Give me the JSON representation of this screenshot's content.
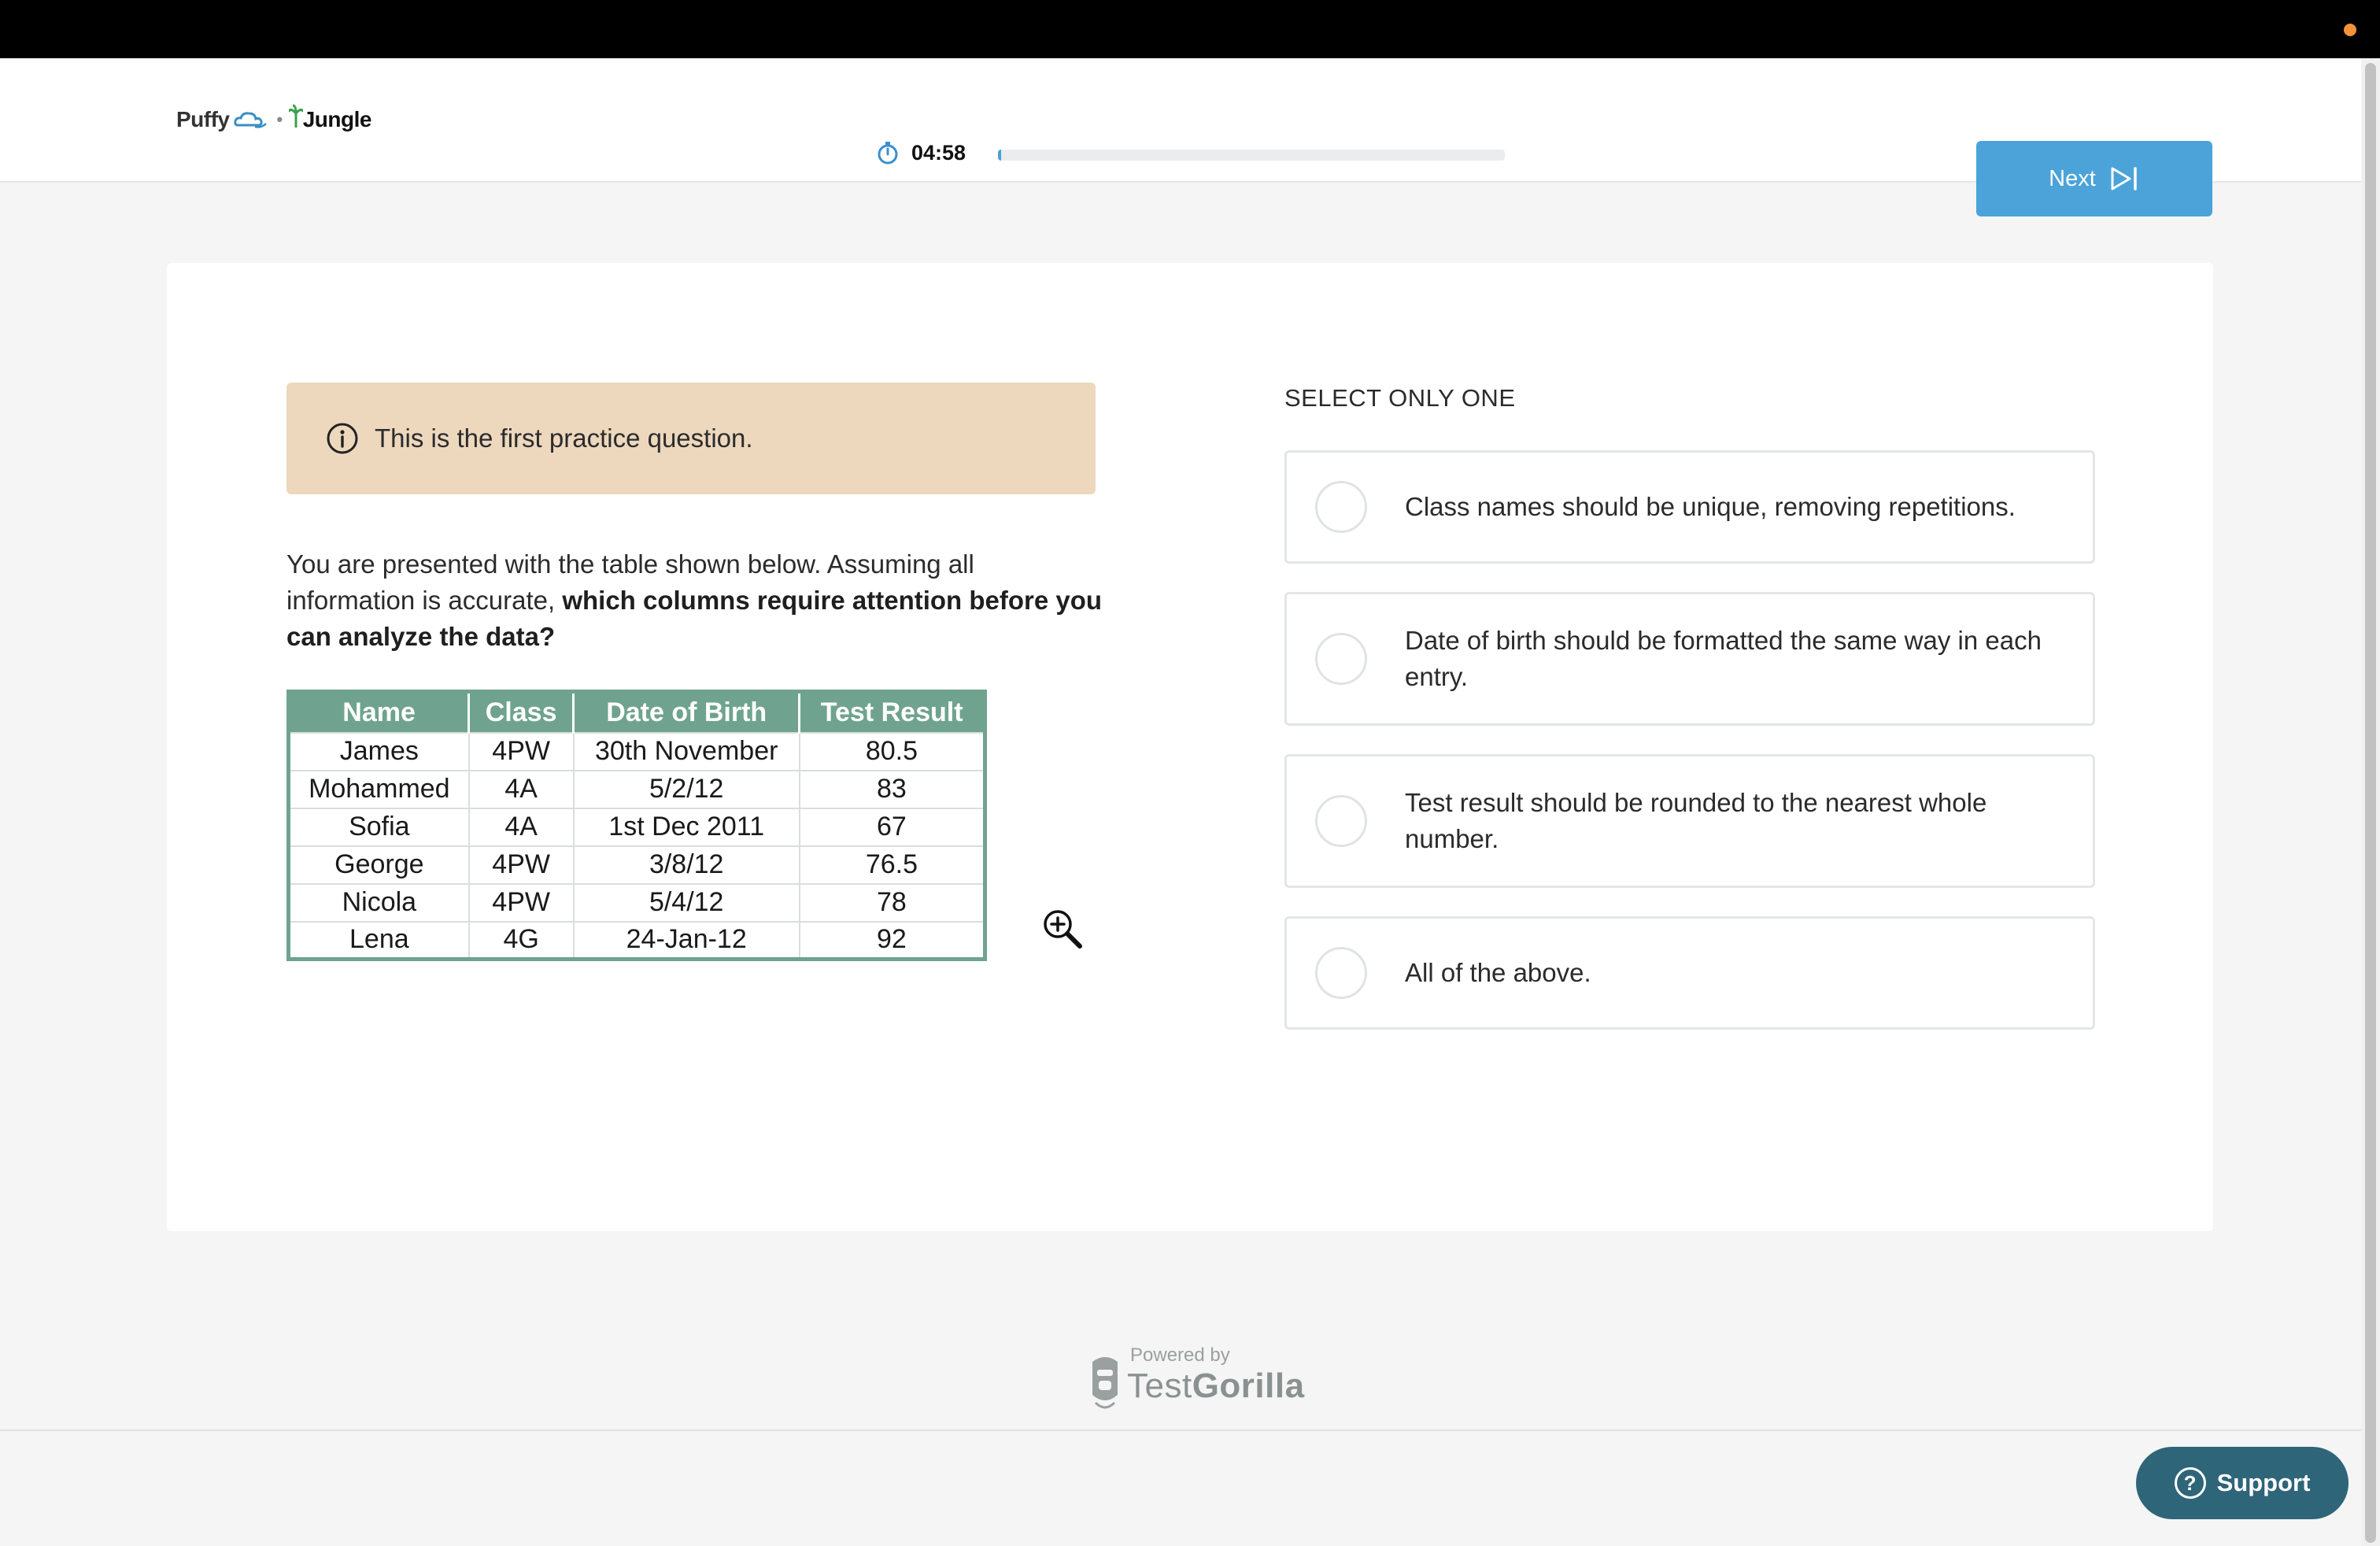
{
  "header": {
    "logo": {
      "left": "Puffy",
      "separator": "•",
      "right": "Jungle"
    },
    "timer": {
      "text": "04:58",
      "progress_fraction": 0.004
    },
    "next_label": "Next"
  },
  "notice": {
    "text": "This is the first practice question."
  },
  "question": {
    "text_plain": "You are presented with the table shown below. Assuming all information is accurate, ",
    "text_bold": "which columns require attention before you can analyze the data?"
  },
  "table": {
    "headers": [
      "Name",
      "Class",
      "Date of Birth",
      "Test Result"
    ],
    "rows": [
      [
        "James",
        "4PW",
        "30th November",
        "80.5"
      ],
      [
        "Mohammed",
        "4A",
        "5/2/12",
        "83"
      ],
      [
        "Sofia",
        "4A",
        "1st Dec 2011",
        "67"
      ],
      [
        "George",
        "4PW",
        "3/8/12",
        "76.5"
      ],
      [
        "Nicola",
        "4PW",
        "5/4/12",
        "78"
      ],
      [
        "Lena",
        "4G",
        "24-Jan-12",
        "92"
      ]
    ]
  },
  "answers": {
    "label": "SELECT ONLY ONE",
    "options": [
      "Class names should be unique, removing repetitions.",
      "Date of birth should be formatted the same way in each entry.",
      "Test result should be rounded to the nearest whole number.",
      "All of the above."
    ]
  },
  "footer": {
    "powered_by": "Powered by",
    "brand_light": "Test",
    "brand_bold": "Gorilla",
    "support_label": "Support"
  },
  "colors": {
    "accent": "#4ba3d9",
    "notice_bg": "#edd8be",
    "table_header": "#6fa38f",
    "support": "#2e6579"
  }
}
